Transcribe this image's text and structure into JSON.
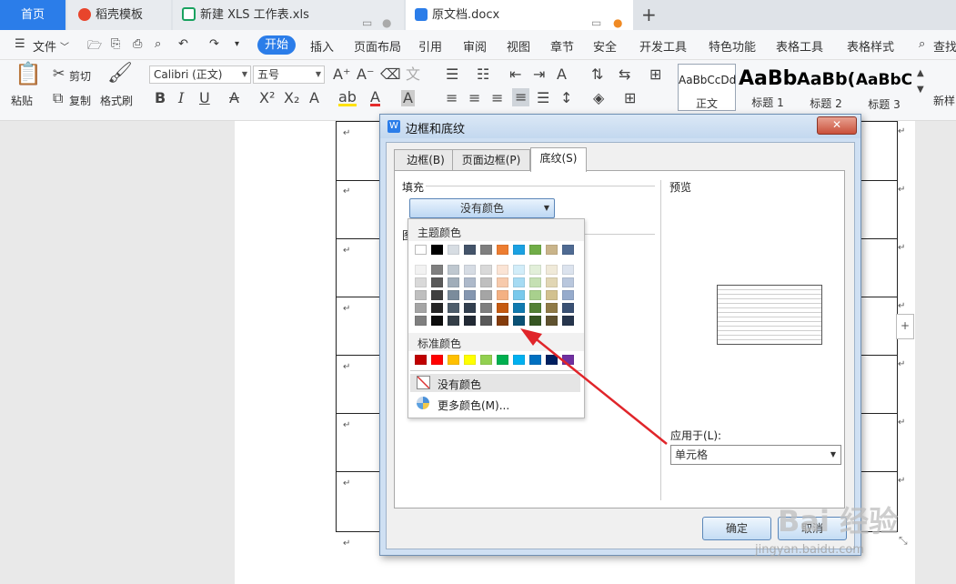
{
  "tabs": [
    {
      "label": "首页",
      "active": true
    },
    {
      "label": "稻壳模板"
    },
    {
      "label": "新建 XLS 工作表.xls"
    },
    {
      "label": "原文档.docx"
    }
  ],
  "tab_add": "+",
  "menu": {
    "file": "文件",
    "items": [
      "开始",
      "插入",
      "页面布局",
      "引用",
      "审阅",
      "视图",
      "章节",
      "安全",
      "开发工具",
      "特色功能",
      "表格工具",
      "表格样式"
    ],
    "search": "查找"
  },
  "ribbon": {
    "paste": "粘贴",
    "cut": "剪切",
    "copy": "复制",
    "format_painter": "格式刷",
    "font": "Calibri (正文)",
    "size": "五号",
    "styles": [
      {
        "preview": "AaBbCcDd",
        "name": "正文"
      },
      {
        "preview": "AaBb",
        "name": "标题 1"
      },
      {
        "preview": "AaBb(",
        "name": "标题 2"
      },
      {
        "preview": "AaBbC",
        "name": "标题 3"
      },
      {
        "preview": "",
        "name": "新样"
      }
    ]
  },
  "dialog": {
    "title": "边框和底纹",
    "close": "✕",
    "tabs": [
      "边框(B)",
      "页面边框(P)",
      "底纹(S)"
    ],
    "fill_label": "填充",
    "fill_value": "没有颜色",
    "pattern_label": "图",
    "preview_label": "预览",
    "apply_label": "应用于(L):",
    "apply_value": "单元格",
    "ok": "确定",
    "cancel": "取消"
  },
  "palette": {
    "theme_label": "主题颜色",
    "theme_row": [
      "#ffffff",
      "#000000",
      "#d7dde3",
      "#44546a",
      "#7f7f7f",
      "#ed7d31",
      "#1ba1e2",
      "#70ad47",
      "#c9b48a",
      "#4f6a92"
    ],
    "shades": [
      [
        "#f2f2f2",
        "#7f7f7f",
        "#bfc8d0",
        "#d6dce4",
        "#d9d9d9",
        "#fbe4d5",
        "#d2edf9",
        "#e2efd9",
        "#f0ead9",
        "#dce3ee"
      ],
      [
        "#d9d9d9",
        "#595959",
        "#a0adb9",
        "#adb9ca",
        "#bfbfbf",
        "#f7caac",
        "#a6dbf3",
        "#c5e0b3",
        "#e1d6b4",
        "#b9c7dd"
      ],
      [
        "#bfbfbf",
        "#3f3f3f",
        "#7b8c9c",
        "#8496b0",
        "#a5a5a5",
        "#f4b183",
        "#79c9ec",
        "#a8d08d",
        "#d2c18f",
        "#96abcc"
      ],
      [
        "#a5a5a5",
        "#262626",
        "#4e5d6b",
        "#323f4f",
        "#7f7f7f",
        "#c55a11",
        "#0f7ab0",
        "#538135",
        "#8f7a47",
        "#3a5174"
      ],
      [
        "#7f7f7f",
        "#0d0d0d",
        "#343e47",
        "#222a35",
        "#595959",
        "#843c0c",
        "#0a5175",
        "#375623",
        "#5f5230",
        "#27364d"
      ]
    ],
    "standard_label": "标准颜色",
    "standard": [
      "#c00000",
      "#ff0000",
      "#ffc000",
      "#ffff00",
      "#92d050",
      "#00b050",
      "#00b0f0",
      "#0070c0",
      "#002060",
      "#7030a0"
    ],
    "no_color": "没有颜色",
    "more_colors": "更多颜色(M)..."
  },
  "watermark": "Bai 经验",
  "watermark_url": "jingyan.baidu.com"
}
